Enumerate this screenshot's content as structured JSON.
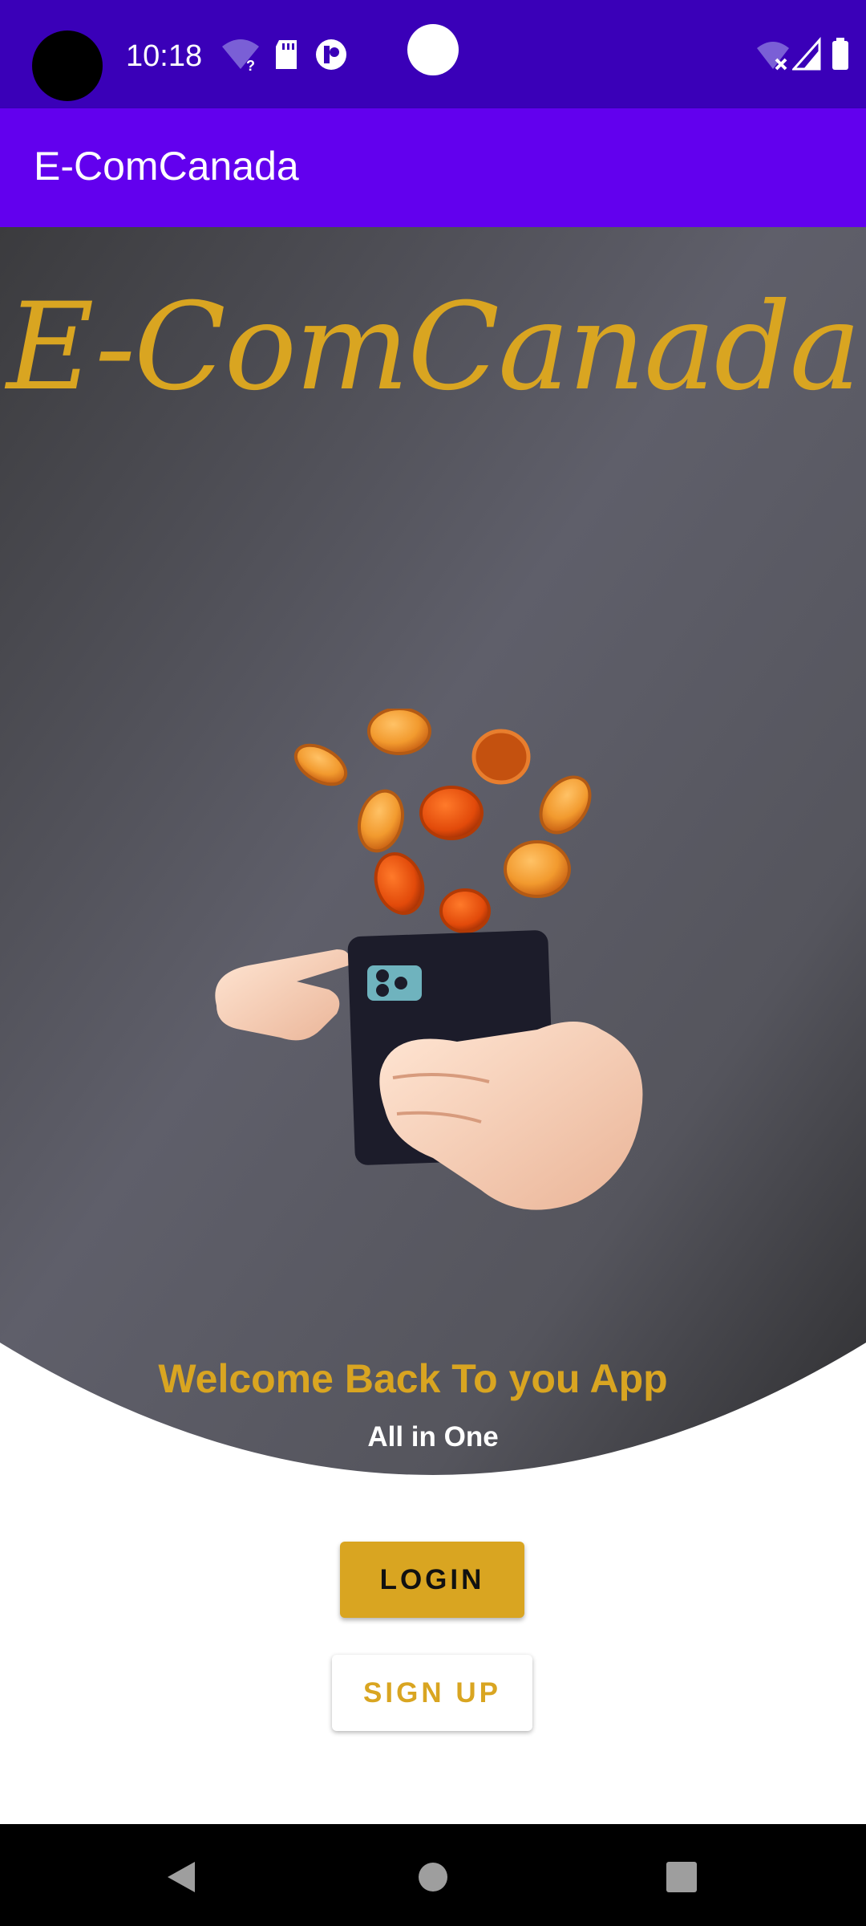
{
  "status_bar": {
    "time": "10:18",
    "icons": [
      "camera-cutout",
      "wifi-question-icon",
      "sd-card-icon",
      "app-notification-icon",
      "wifi-off-icon",
      "cell-signal-icon",
      "battery-icon"
    ]
  },
  "app_bar": {
    "title": "E-ComCanada"
  },
  "hero": {
    "brand_script": "E-ComCanada",
    "illustration": "hand-holding-phone-with-coins",
    "welcome": "Welcome Back To you App",
    "tagline": "All in One"
  },
  "actions": {
    "login": "LOGIN",
    "signup": "SIGN UP"
  },
  "nav_bar": {
    "icons": [
      "back-icon",
      "home-icon",
      "recents-icon"
    ]
  },
  "colors": {
    "status_bar": "#3a00b8",
    "app_bar": "#6200ee",
    "accent_gold": "#d9a521",
    "hero_dark": "#3a3a3d"
  }
}
